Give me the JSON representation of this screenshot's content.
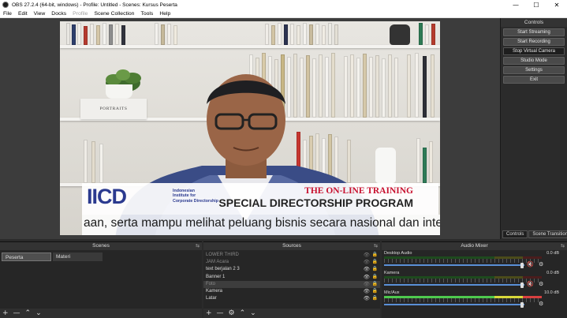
{
  "window": {
    "title": "OBS 27.2.4 (64-bit, windows) - Profile: Untitled - Scenes: Kursus Peserta",
    "minimize": "—",
    "maximize": "☐",
    "close": "✕"
  },
  "menubar": {
    "items": [
      "File",
      "Edit",
      "View",
      "Docks",
      "Profile",
      "Scene Collection",
      "Tools",
      "Help"
    ]
  },
  "preview": {
    "portrait_label": "PORTRAITS",
    "logo_text": "IICD",
    "logo_sub": [
      "Indonesian",
      "Institute for",
      "Corporate Directorship"
    ],
    "headline": "THE ON-LINE TRAINING",
    "program": "SPECIAL DIRECTORSHIP PROGRAM",
    "ticker": "aan, serta mampu melihat peluang bisnis secara nasional dan internasi"
  },
  "controls": {
    "title": "Controls",
    "buttons": [
      "Start Streaming",
      "Start Recording",
      "Stop Virtual Camera",
      "Studio Mode",
      "Settings",
      "Exit"
    ],
    "active_index": 2,
    "tabs": [
      "Controls",
      "Scene Transitions"
    ]
  },
  "scenes": {
    "title": "Scenes",
    "items": [
      "Peserta",
      "Materi"
    ]
  },
  "sources": {
    "title": "Sources",
    "items": [
      {
        "label": "LOWER THIRD",
        "visible": false
      },
      {
        "label": "JAM Acara",
        "visible": false
      },
      {
        "label": "text berjalan 2 3",
        "visible": true
      },
      {
        "label": "Banner 1",
        "visible": true
      },
      {
        "label": "Foto",
        "visible": false
      },
      {
        "label": "Kamera",
        "visible": true
      },
      {
        "label": "Latar",
        "visible": true
      }
    ]
  },
  "mixer": {
    "title": "Audio Mixer",
    "channels": [
      {
        "name": "Desktop Audio",
        "db": "0.0 dB",
        "muted": true
      },
      {
        "name": "Kamera",
        "db": "0.0 dB",
        "muted": true
      },
      {
        "name": "Mic/Aux",
        "db": "10.0 dB",
        "muted": false
      }
    ]
  },
  "icons": {
    "add": "+",
    "remove": "—",
    "gear": "⚙",
    "up": "⌃",
    "down": "⌄",
    "eye": "👁",
    "lock": "🔒",
    "mute": "🔇",
    "float": "⇆"
  }
}
